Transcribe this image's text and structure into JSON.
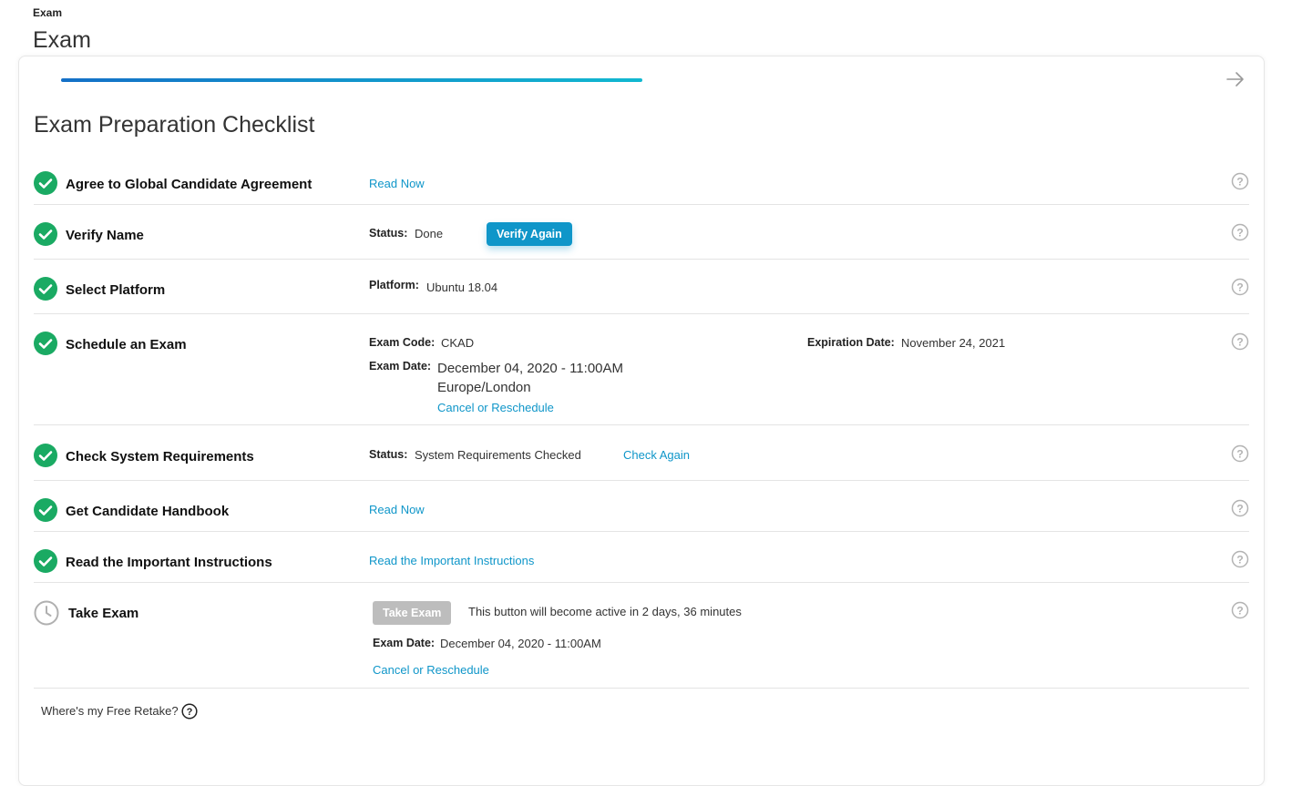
{
  "header": {
    "breadcrumb": "Exam",
    "title": "Exam"
  },
  "progress": 0.47,
  "checklist": {
    "title": "Exam Preparation Checklist",
    "steps": [
      {
        "label": "Agree to Global Candidate Agreement",
        "status_icon": "check-circle-icon",
        "link": "Read Now"
      },
      {
        "label": "Verify Name",
        "status_icon": "check-circle-icon",
        "status_key": "Status:",
        "status_val": "Done",
        "button": "Verify Again"
      },
      {
        "label": "Select Platform",
        "status_icon": "check-circle-icon",
        "platform_key": "Platform:",
        "platform_val": "Ubuntu 18.04"
      },
      {
        "label": "Schedule an Exam",
        "status_icon": "check-circle-icon",
        "code_key": "Exam Code:",
        "code_val": "CKAD",
        "exp_key": "Expiration Date:",
        "exp_val": "November 24, 2021",
        "date_key": "Exam Date:",
        "date_val": "December 04, 2020 - 11:00AM",
        "tz": "Europe/London",
        "link": "Cancel or Reschedule"
      },
      {
        "label": "Check System Requirements",
        "status_icon": "check-circle-icon",
        "status_key": "Status:",
        "status_val": "System Requirements Checked",
        "link": "Check Again"
      },
      {
        "label": "Get Candidate Handbook",
        "status_icon": "check-circle-icon",
        "link": "Read Now"
      },
      {
        "label": "Read the Important Instructions",
        "status_icon": "check-circle-icon",
        "link": "Read the Important Instructions"
      },
      {
        "label": "Take Exam",
        "status_icon": "clock-icon",
        "button": "Take Exam",
        "note": "This button will become active in 2 days, 36 minutes",
        "date_key": "Exam Date:",
        "date_val": "December 04, 2020 - 11:00AM",
        "link": "Cancel or Reschedule"
      }
    ]
  },
  "footer": {
    "retake_text": "Where's my Free Retake?"
  },
  "colors": {
    "accent": "#0f96c9",
    "success": "#1aaa63",
    "progress_start": "#1470c7",
    "progress_end": "#11b8d0"
  }
}
